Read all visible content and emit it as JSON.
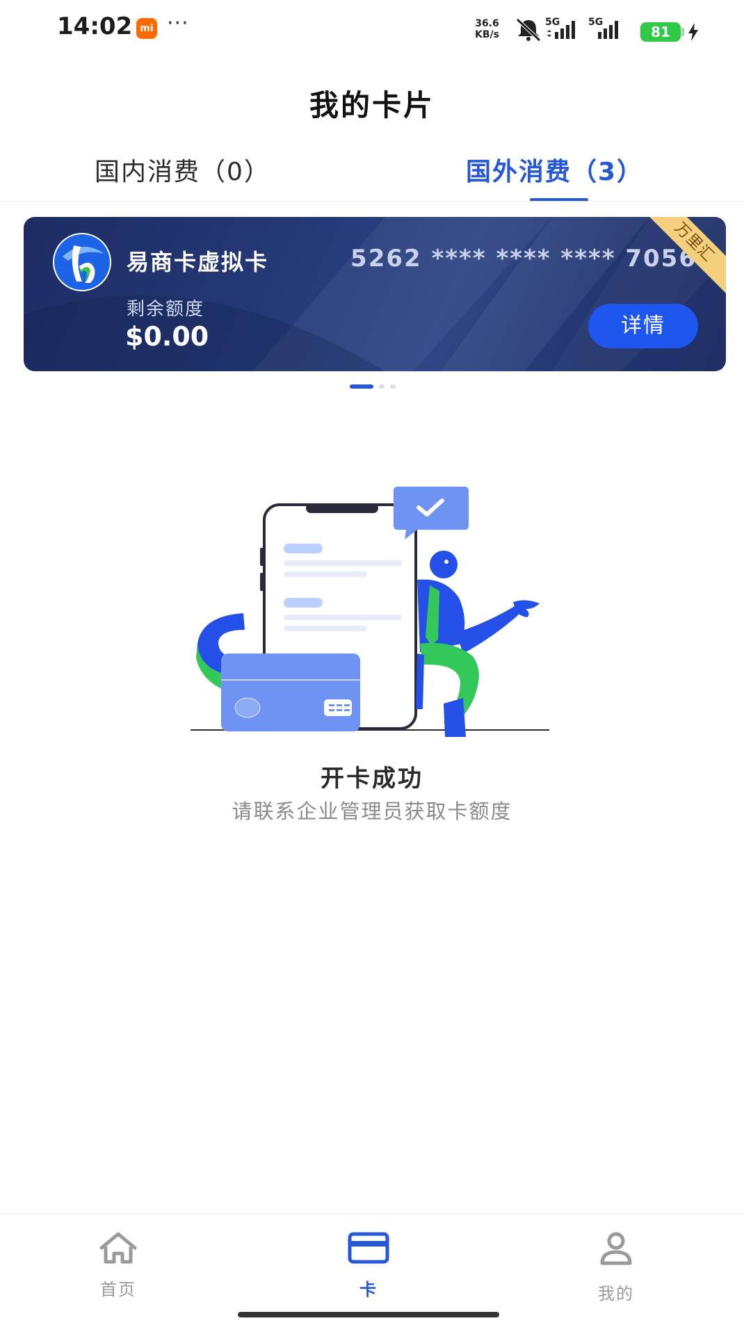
{
  "status_bar": {
    "time": "14:02",
    "mi_badge": "mi",
    "more": "···",
    "net_speed_value": "36.6",
    "net_speed_unit": "KB/s",
    "signal_1": "5G",
    "signal_2": "5G",
    "battery": "81",
    "icons": [
      "mute-bell-icon",
      "signal-icon",
      "battery-icon",
      "charging-icon"
    ]
  },
  "header": {
    "title": "我的卡片"
  },
  "tabs": [
    {
      "label": "国内消费（0）",
      "active": false
    },
    {
      "label": "国外消费（3）",
      "active": true
    }
  ],
  "card": {
    "name": "易商卡虚拟卡",
    "number": "5262 **** **** **** 7056",
    "balance_label": "剩余额度",
    "balance": "$0.00",
    "details_label": "详情",
    "ribbon": "万里汇"
  },
  "pager": {
    "count": 3,
    "active_index": 0
  },
  "empty_state": {
    "title": "开卡成功",
    "subtitle": "请联系企业管理员获取卡额度"
  },
  "bottom_nav": [
    {
      "label": "首页",
      "icon": "home-icon",
      "active": false
    },
    {
      "label": "卡",
      "icon": "card-icon",
      "active": true
    },
    {
      "label": "我的",
      "icon": "person-icon",
      "active": false
    }
  ],
  "colors": {
    "accent": "#2657d6",
    "card_bg": "#253a78",
    "button": "#1f56f0",
    "ribbon": "#f3cf7e",
    "battery": "#2ec946"
  }
}
